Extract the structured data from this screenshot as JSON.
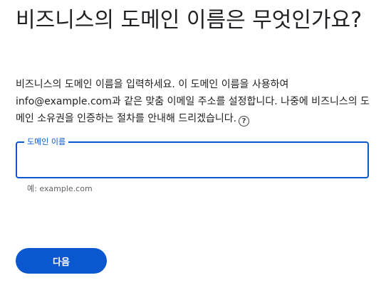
{
  "page": {
    "title": "비즈니스의 도메인 이름은 무엇인가요?",
    "description": "비즈니스의 도메인 이름을 입력하세요. 이 도메인 이름을 사용하여 info@example.com과 같은 맞춤 이메일 주소를 설정합니다. 나중에 비즈니스의 도메인 소유권을 인증하는 절차를 안내해 드리겠습니다.",
    "help_icon": "?"
  },
  "domain_field": {
    "label": "도메인 이름",
    "value": "",
    "hint": "예: example.com"
  },
  "actions": {
    "next_label": "다음"
  },
  "colors": {
    "accent": "#0b57d0",
    "text": "#202124",
    "hint": "#5f6368"
  }
}
